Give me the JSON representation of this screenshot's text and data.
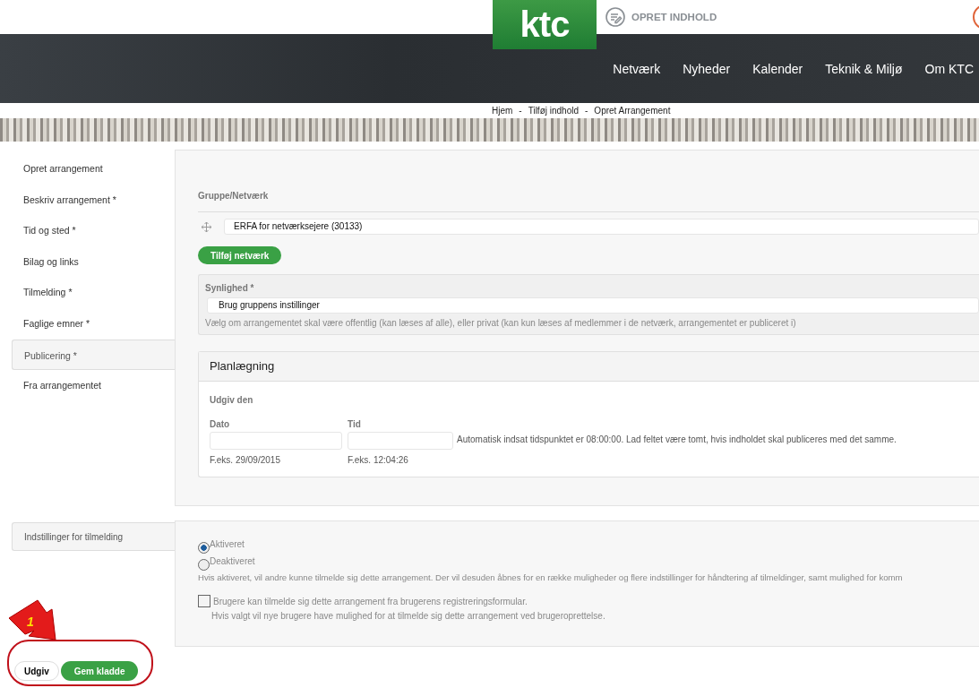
{
  "header": {
    "logo": "ktc",
    "create_link": "OPRET INDHOLD"
  },
  "nav": [
    "Netværk",
    "Nyheder",
    "Kalender",
    "Teknik & Miljø",
    "Om KTC"
  ],
  "breadcrumb": [
    "Hjem",
    "Tilføj indhold",
    "Opret Arrangement"
  ],
  "breadcrumb_separator": "-",
  "sidebar": {
    "items": [
      {
        "label": "Opret arrangement",
        "selected": false
      },
      {
        "label": "Beskriv arrangement *",
        "selected": false
      },
      {
        "label": "Tid og sted *",
        "selected": false
      },
      {
        "label": "Bilag og links",
        "selected": false
      },
      {
        "label": "Tilmelding *",
        "selected": false
      },
      {
        "label": "Faglige emner *",
        "selected": false
      },
      {
        "label": "Publicering *",
        "selected": true
      },
      {
        "label": "Fra arrangementet",
        "selected": false
      }
    ]
  },
  "group": {
    "label": "Gruppe/Netværk",
    "value": "ERFA for netværksejere (30133)",
    "add_button": "Tilføj netværk"
  },
  "visibility": {
    "label": "Synlighed *",
    "value": "Brug gruppens instillinger",
    "help": "Vælg om arrangementet skal være offentlig (kan læses af alle), eller privat (kan kun læses af medlemmer i de netværk, arrangementet er publiceret i)"
  },
  "planning": {
    "title": "Planlægning",
    "subtitle": "Udgiv den",
    "date_label": "Dato",
    "date_example": "F.eks. 29/09/2015",
    "time_label": "Tid",
    "time_example": "F.eks. 12:04:26",
    "help": "Automatisk indsat tidspunktet er 08:00:00. Lad feltet være tomt, hvis indholdet skal publiceres med det samme."
  },
  "registration": {
    "tab": "Indstillinger for tilmelding",
    "options": [
      {
        "label": "Aktiveret",
        "selected": true
      },
      {
        "label": "Deaktiveret",
        "selected": false
      }
    ],
    "help": "Hvis aktiveret, vil andre kunne tilmelde sig dette arrangement. Der vil desuden åbnes for en række muligheder og flere indstillinger for håndtering af tilmeldinger, samt mulighed for komm",
    "checkbox": {
      "label": "Brugere kan tilmelde sig dette arrangement fra brugerens registreringsformular.",
      "checked": false,
      "help": "Hvis valgt vil nye brugere have mulighed for at tilmelde sig dette arrangement ved brugeroprettelse."
    }
  },
  "actions": {
    "publish": "Udgiv",
    "save_draft": "Gem kladde"
  },
  "annotation": {
    "number": "1"
  }
}
